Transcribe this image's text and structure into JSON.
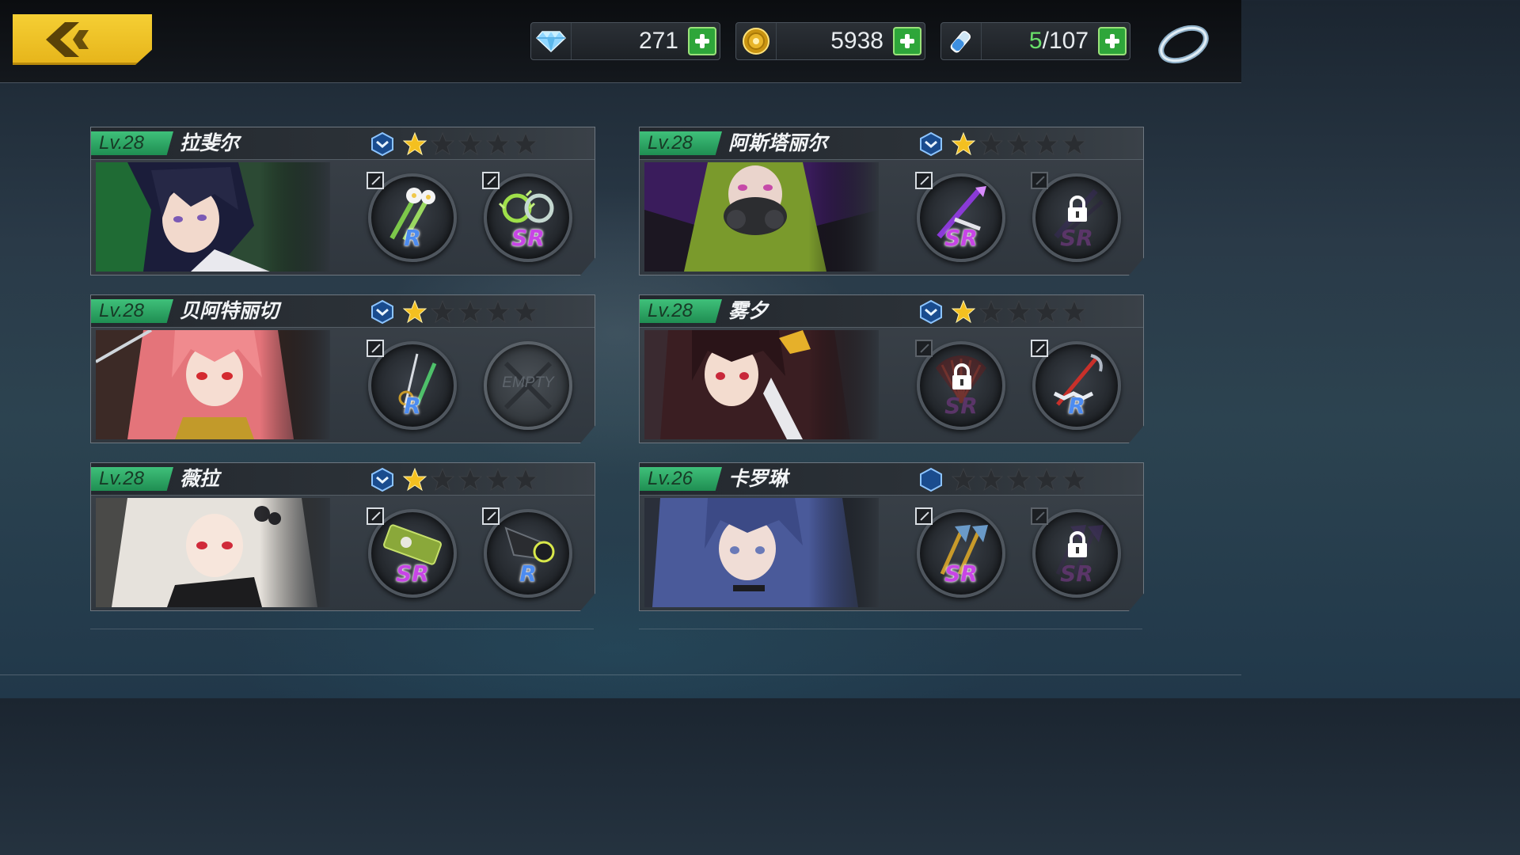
{
  "currencies": {
    "gems": {
      "icon": "diamond-icon",
      "value": "271"
    },
    "gold": {
      "icon": "gold-coin-icon",
      "value": "5938"
    },
    "stamina": {
      "icon": "potion-vial-icon",
      "current": "5",
      "max": "/107"
    }
  },
  "characters": [
    {
      "level": "Lv.28",
      "name": "拉斐尔",
      "rank_icon": "rank-chevron-icon",
      "stars": 1,
      "weapons": [
        {
          "rarity": "R",
          "icon": "twin-flower-blades-icon",
          "locked": false,
          "empty": false
        },
        {
          "rarity": "SR",
          "icon": "chakram-rings-icon",
          "locked": false,
          "empty": false
        }
      ]
    },
    {
      "level": "Lv.28",
      "name": "阿斯塔丽尔",
      "rank_icon": "rank-chevron-icon",
      "stars": 1,
      "weapons": [
        {
          "rarity": "SR",
          "icon": "violet-lance-icon",
          "locked": false,
          "empty": false
        },
        {
          "rarity": "SR",
          "icon": "dark-blade-icon",
          "locked": true,
          "empty": false
        }
      ]
    },
    {
      "level": "Lv.28",
      "name": "贝阿特丽切",
      "rank_icon": "rank-chevron-icon",
      "stars": 1,
      "weapons": [
        {
          "rarity": "R",
          "icon": "rapier-sword-icon",
          "locked": false,
          "empty": false
        },
        {
          "rarity": "",
          "icon": "empty-slot-icon",
          "locked": false,
          "empty": true,
          "empty_label": "EMPTY"
        }
      ]
    },
    {
      "level": "Lv.28",
      "name": "雾夕",
      "rank_icon": "rank-chevron-icon",
      "stars": 1,
      "weapons": [
        {
          "rarity": "SR",
          "icon": "feather-fan-icon",
          "locked": true,
          "empty": false
        },
        {
          "rarity": "R",
          "icon": "chain-scythe-icon",
          "locked": false,
          "empty": false
        }
      ]
    },
    {
      "level": "Lv.28",
      "name": "薇拉",
      "rank_icon": "rank-chevron-icon",
      "stars": 1,
      "weapons": [
        {
          "rarity": "SR",
          "icon": "death-cannon-icon",
          "locked": false,
          "empty": false
        },
        {
          "rarity": "R",
          "icon": "blaster-gun-icon",
          "locked": false,
          "empty": false
        }
      ]
    },
    {
      "level": "Lv.26",
      "name": "卡罗琳",
      "rank_icon": "rank-hexagon-icon",
      "stars": 0,
      "weapons": [
        {
          "rarity": "SR",
          "icon": "twin-axes-icon",
          "locked": false,
          "empty": false
        },
        {
          "rarity": "SR",
          "icon": "shadow-axes-icon",
          "locked": true,
          "empty": false
        }
      ]
    }
  ],
  "colors": {
    "accent_yellow": "#f5cf34",
    "level_green": "#3fc07a",
    "rarity_r": "#4d8cf0",
    "rarity_sr": "#c845e6",
    "plus_green": "#2ea63a",
    "star_gold": "#f4c020",
    "star_empty": "#2a2d31"
  }
}
